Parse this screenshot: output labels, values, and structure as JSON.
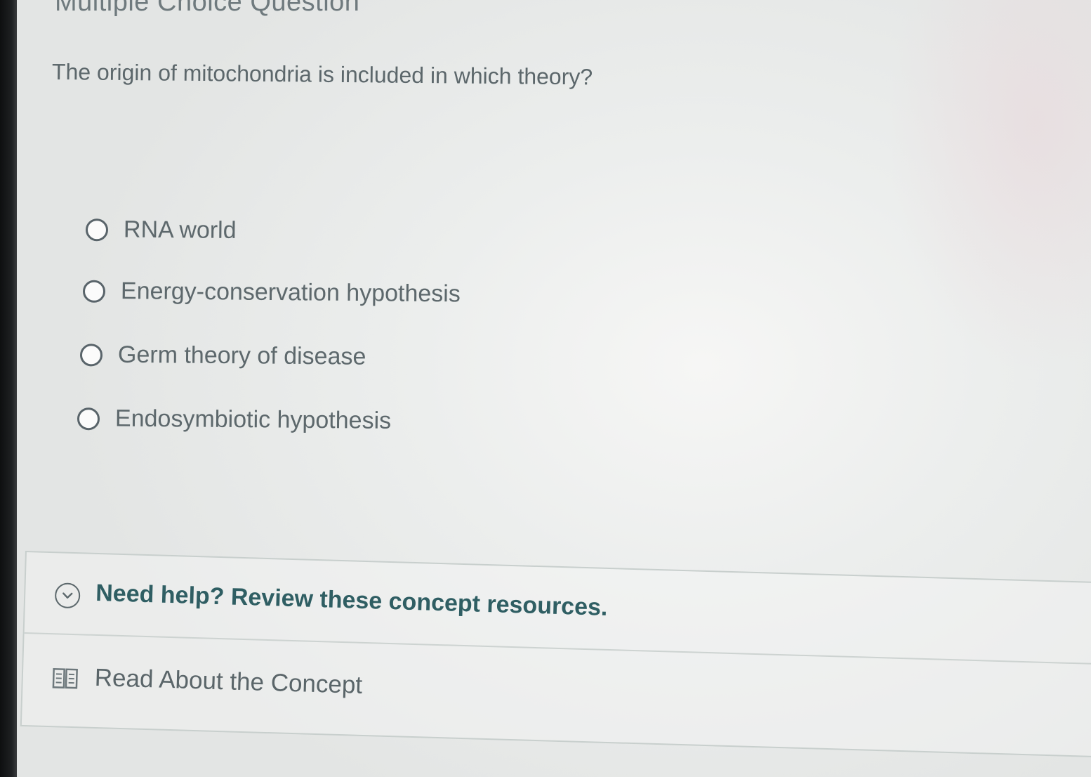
{
  "header": {
    "title": "Multiple Choice Question"
  },
  "question": {
    "text": "The origin of mitochondria is included in which theory?"
  },
  "options": [
    {
      "label": "RNA world",
      "selected": false
    },
    {
      "label": "Energy-conservation hypothesis",
      "selected": false
    },
    {
      "label": "Germ theory of disease",
      "selected": false
    },
    {
      "label": "Endosymbiotic hypothesis",
      "selected": false
    }
  ],
  "help": {
    "title": "Need help? Review these concept resources.",
    "toggle_icon": "chevron-down-circle-icon",
    "resources": [
      {
        "label": "Read About the Concept",
        "icon": "book-icon"
      }
    ]
  },
  "colors": {
    "help_title": "#2f5e63",
    "text": "#5d686c",
    "border": "#c8cfcd"
  }
}
